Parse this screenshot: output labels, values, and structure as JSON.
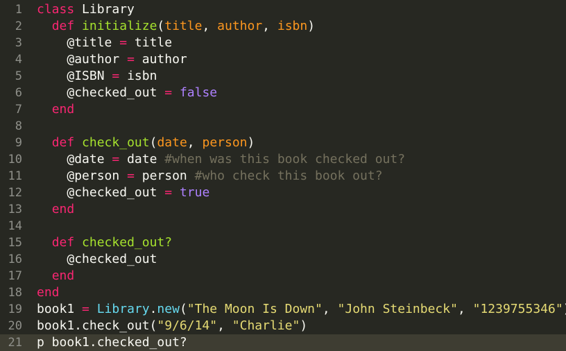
{
  "editor": {
    "theme_colors": {
      "background": "#272822",
      "current_line": "#3E3D32",
      "keyword": "#F92672",
      "function": "#A6E22E",
      "parameter": "#FD971F",
      "boolean": "#AE81FF",
      "comment": "#75715E",
      "string": "#E6DB74",
      "class_ref": "#66D9EF",
      "text": "#F8F8F2",
      "line_number": "#8F908A"
    },
    "current_line": 21,
    "lines": [
      {
        "num": "1",
        "indent": 0,
        "tokens": [
          {
            "t": "class",
            "k": "kw"
          },
          {
            "t": " Library",
            "k": "txt"
          }
        ]
      },
      {
        "num": "2",
        "indent": 1,
        "tokens": [
          {
            "t": "def",
            "k": "kw"
          },
          {
            "t": " ",
            "k": "txt"
          },
          {
            "t": "initialize",
            "k": "fn"
          },
          {
            "t": "(",
            "k": "txt"
          },
          {
            "t": "title",
            "k": "param"
          },
          {
            "t": ", ",
            "k": "txt"
          },
          {
            "t": "author",
            "k": "param"
          },
          {
            "t": ", ",
            "k": "txt"
          },
          {
            "t": "isbn",
            "k": "param"
          },
          {
            "t": ")",
            "k": "txt"
          }
        ]
      },
      {
        "num": "3",
        "indent": 2,
        "tokens": [
          {
            "t": "@title ",
            "k": "txt"
          },
          {
            "t": "=",
            "k": "op"
          },
          {
            "t": " title",
            "k": "txt"
          }
        ]
      },
      {
        "num": "4",
        "indent": 2,
        "tokens": [
          {
            "t": "@author ",
            "k": "txt"
          },
          {
            "t": "=",
            "k": "op"
          },
          {
            "t": " author",
            "k": "txt"
          }
        ]
      },
      {
        "num": "5",
        "indent": 2,
        "tokens": [
          {
            "t": "@ISBN ",
            "k": "txt"
          },
          {
            "t": "=",
            "k": "op"
          },
          {
            "t": " isbn",
            "k": "txt"
          }
        ]
      },
      {
        "num": "6",
        "indent": 2,
        "tokens": [
          {
            "t": "@checked_out ",
            "k": "txt"
          },
          {
            "t": "=",
            "k": "op"
          },
          {
            "t": " ",
            "k": "txt"
          },
          {
            "t": "false",
            "k": "bool"
          }
        ]
      },
      {
        "num": "7",
        "indent": 1,
        "tokens": [
          {
            "t": "end",
            "k": "kw"
          }
        ]
      },
      {
        "num": "8",
        "indent": 0,
        "tokens": []
      },
      {
        "num": "9",
        "indent": 1,
        "tokens": [
          {
            "t": "def",
            "k": "kw"
          },
          {
            "t": " ",
            "k": "txt"
          },
          {
            "t": "check_out",
            "k": "fn"
          },
          {
            "t": "(",
            "k": "txt"
          },
          {
            "t": "date",
            "k": "param"
          },
          {
            "t": ", ",
            "k": "txt"
          },
          {
            "t": "person",
            "k": "param"
          },
          {
            "t": ")",
            "k": "txt"
          }
        ]
      },
      {
        "num": "10",
        "indent": 2,
        "tokens": [
          {
            "t": "@date ",
            "k": "txt"
          },
          {
            "t": "=",
            "k": "op"
          },
          {
            "t": " date ",
            "k": "txt"
          },
          {
            "t": "#when was this book checked out?",
            "k": "cm"
          }
        ]
      },
      {
        "num": "11",
        "indent": 2,
        "tokens": [
          {
            "t": "@person ",
            "k": "txt"
          },
          {
            "t": "=",
            "k": "op"
          },
          {
            "t": " person ",
            "k": "txt"
          },
          {
            "t": "#who check this book out?",
            "k": "cm"
          }
        ]
      },
      {
        "num": "12",
        "indent": 2,
        "tokens": [
          {
            "t": "@checked_out ",
            "k": "txt"
          },
          {
            "t": "=",
            "k": "op"
          },
          {
            "t": " ",
            "k": "txt"
          },
          {
            "t": "true",
            "k": "bool"
          }
        ]
      },
      {
        "num": "13",
        "indent": 1,
        "tokens": [
          {
            "t": "end",
            "k": "kw"
          }
        ]
      },
      {
        "num": "14",
        "indent": 0,
        "tokens": []
      },
      {
        "num": "15",
        "indent": 1,
        "tokens": [
          {
            "t": "def",
            "k": "kw"
          },
          {
            "t": " ",
            "k": "txt"
          },
          {
            "t": "checked_out?",
            "k": "fn"
          }
        ]
      },
      {
        "num": "16",
        "indent": 2,
        "tokens": [
          {
            "t": "@checked_out",
            "k": "txt"
          }
        ]
      },
      {
        "num": "17",
        "indent": 1,
        "tokens": [
          {
            "t": "end",
            "k": "kw"
          }
        ]
      },
      {
        "num": "18",
        "indent": 0,
        "tokens": [
          {
            "t": "end",
            "k": "kw"
          }
        ]
      },
      {
        "num": "19",
        "indent": 0,
        "tokens": [
          {
            "t": "book1 ",
            "k": "txt"
          },
          {
            "t": "=",
            "k": "op"
          },
          {
            "t": " ",
            "k": "txt"
          },
          {
            "t": "Library",
            "k": "cls"
          },
          {
            "t": ".",
            "k": "txt"
          },
          {
            "t": "new",
            "k": "cls"
          },
          {
            "t": "(",
            "k": "txt"
          },
          {
            "t": "\"The Moon Is Down\"",
            "k": "str"
          },
          {
            "t": ", ",
            "k": "txt"
          },
          {
            "t": "\"John Steinbeck\"",
            "k": "str"
          },
          {
            "t": ", ",
            "k": "txt"
          },
          {
            "t": "\"1239755346\"",
            "k": "str"
          },
          {
            "t": ")",
            "k": "txt"
          }
        ]
      },
      {
        "num": "20",
        "indent": 0,
        "tokens": [
          {
            "t": "book1.check_out(",
            "k": "txt"
          },
          {
            "t": "\"9/6/14\"",
            "k": "str"
          },
          {
            "t": ", ",
            "k": "txt"
          },
          {
            "t": "\"Charlie\"",
            "k": "str"
          },
          {
            "t": ")",
            "k": "txt"
          }
        ]
      },
      {
        "num": "21",
        "indent": 0,
        "tokens": [
          {
            "t": "p book1.checked_out?",
            "k": "txt"
          }
        ]
      }
    ]
  }
}
